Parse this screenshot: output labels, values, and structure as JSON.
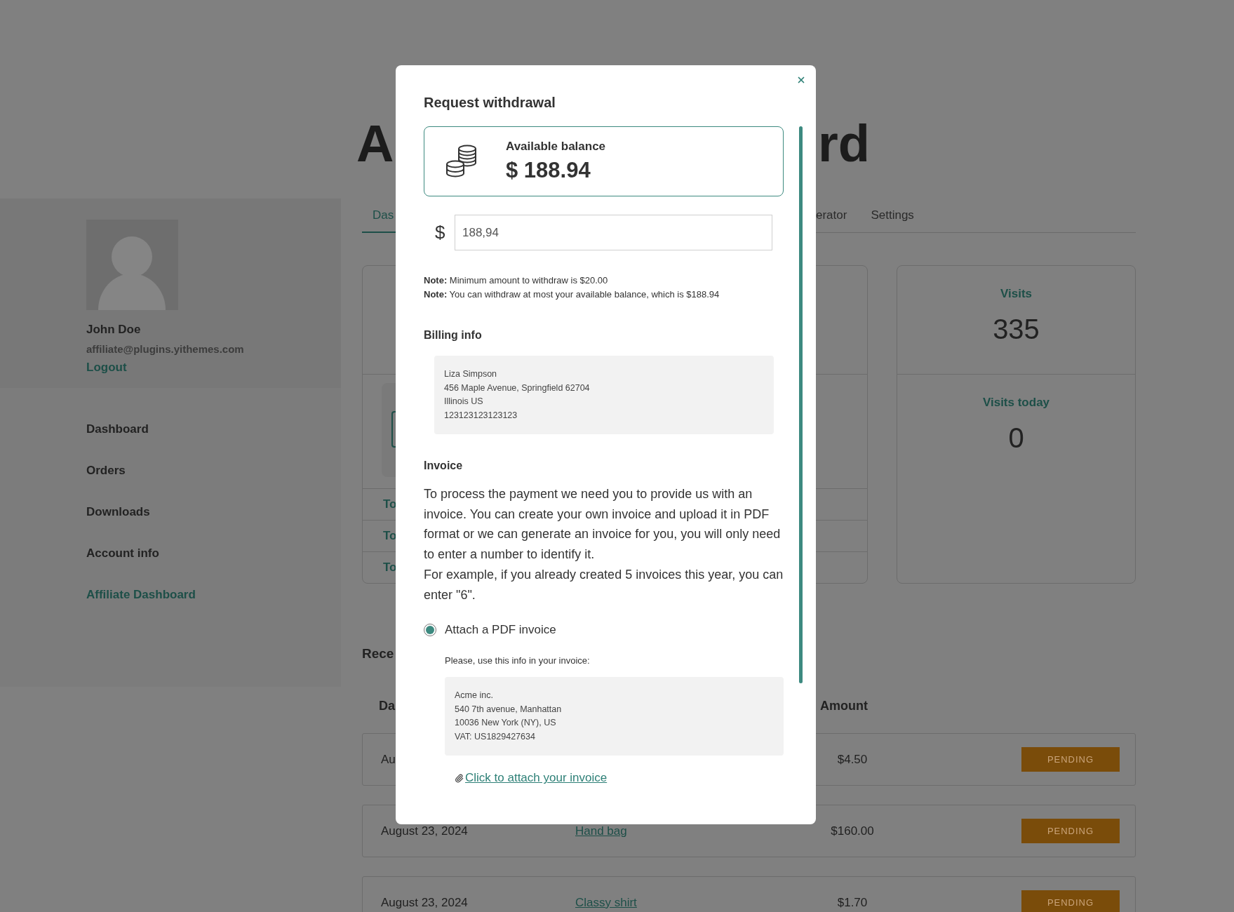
{
  "page": {
    "title_left": "A",
    "title_right": "rd"
  },
  "profile": {
    "name": "John Doe",
    "email": "affiliate@plugins.yithemes.com",
    "logout": "Logout"
  },
  "nav": [
    {
      "label": "Dashboard",
      "selected": false
    },
    {
      "label": "Orders",
      "selected": false
    },
    {
      "label": "Downloads",
      "selected": false
    },
    {
      "label": "Account info",
      "selected": false
    },
    {
      "label": "Affiliate Dashboard",
      "selected": true
    }
  ],
  "tabs": [
    {
      "label": "Das",
      "selected": true
    },
    {
      "label": "erator",
      "selected": false
    },
    {
      "label": "Settings",
      "selected": false
    }
  ],
  "summary_card": {
    "rows": [
      "To",
      "To",
      "To"
    ]
  },
  "visits_card": {
    "stats": [
      {
        "label": "Visits",
        "value": "335"
      },
      {
        "label": "Visits today",
        "value": "0"
      }
    ]
  },
  "recent": {
    "title": "Rece",
    "columns": [
      "Da",
      "Amount"
    ],
    "rows": [
      {
        "date": "Au",
        "amount": "$4.50",
        "status": "PENDING"
      },
      {
        "date": "August 23, 2024",
        "product": "Hand bag",
        "amount": "$160.00",
        "status": "PENDING"
      },
      {
        "date": "August 23, 2024",
        "product": "Classy shirt",
        "amount": "$1.70",
        "status": "PENDING"
      }
    ]
  },
  "modal": {
    "title": "Request withdrawal",
    "balance_label": "Available balance",
    "balance": "$ 188.94",
    "currency": "$",
    "amount_value": "188,94",
    "notes": [
      "**Note:** Minimum amount to withdraw is $20.00",
      "**Note:** You can withdraw at most your available balance, which is $188.94"
    ],
    "billing_heading": "Billing info",
    "billing_lines": [
      "Liza Simpson",
      "456 Maple Avenue, Springfield 62704",
      "Illinois US",
      "123123123123123"
    ],
    "invoice_heading": "Invoice",
    "invoice_text": [
      "To process the payment we need you to provide us with an invoice. You can create your own invoice and upload it in PDF format or we can generate an invoice for you, you will only need to enter a number to identify it.",
      "For example, if you already created 5 invoices this year, you can enter \"6\"."
    ],
    "options": [
      {
        "label": "Attach a PDF invoice",
        "selected": true
      }
    ],
    "invoice_info_label": "Please, use this info in your invoice:",
    "company_lines": [
      "Acme inc.",
      "540 7th avenue, Manhattan",
      "10036 New York (NY), US",
      "VAT: US1829427634"
    ],
    "attach_link": "Click to attach your invoice"
  }
}
